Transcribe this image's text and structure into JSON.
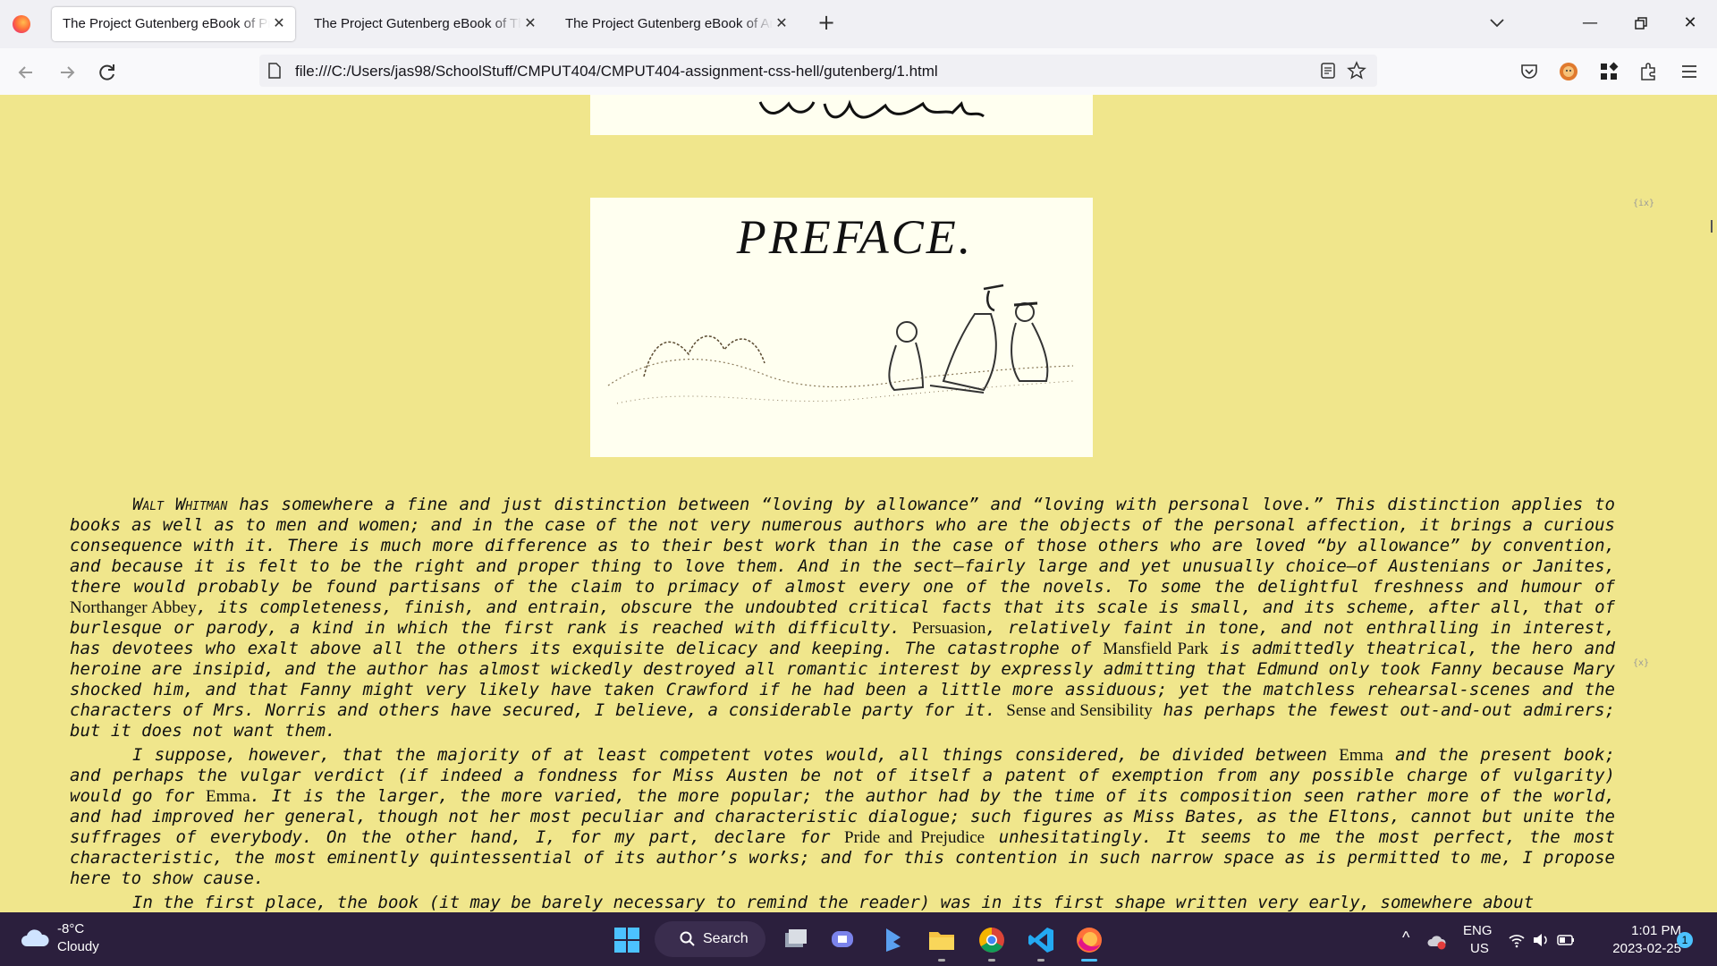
{
  "browser": {
    "tabs": [
      {
        "title": "The Project Gutenberg eBook of Pric",
        "active": true
      },
      {
        "title": "The Project Gutenberg eBook of The",
        "active": false
      },
      {
        "title": "The Project Gutenberg eBook of Ani",
        "active": false
      }
    ],
    "url": "file:///C:/Users/jas98/SchoolStuff/CMPUT404/CMPUT404-assignment-css-hell/gutenberg/1.html"
  },
  "page": {
    "preface_title": "PREFACE.",
    "page_marker_1": "{ix}",
    "page_marker_2": "{x}",
    "para1": {
      "lead": "Walt Whitman",
      "rest": " has somewhere a fine and just distinction between “loving by allowance” and “loving with personal love.” This distinction applies to books as well as to men and women; and in the case of the not very numerous authors who are the objects of the personal affection, it brings a curious consequence with it. There is much more difference as to their best work than in the case of those others who are loved “by allowance” by convention, and because it is felt to be the right and proper thing to love them. And in the sect—fairly large and yet unusually choice—of Austenians or Janites, there would probably be found partisans of the claim to primacy of almost every one of the novels. To some the delightful freshness and humour of ",
      "title1": "Northanger Abbey",
      "rest2": ", its completeness, finish, and entrain, obscure the undoubted critical facts that its scale is small, and its scheme, after all, that of burlesque or parody, a kind in which the first rank is reached with difficulty. ",
      "title2": "Persuasion",
      "rest3": ", relatively faint in tone, and not enthralling in interest, has devotees who exalt above all the others its exquisite delicacy and keeping. The catastrophe of ",
      "title3": "Mansfield Park",
      "rest4": " is admittedly theatrical, the hero and heroine are insipid, and the author has almost wickedly destroyed all romantic interest by expressly admitting that Edmund only took Fanny because Mary shocked him, and that Fanny might very likely have taken Crawford if he had been a little more assiduous; yet the matchless rehearsal-scenes and the characters of Mrs. Norris and others have secured, I believe, a considerable party for it. ",
      "title4": "Sense and Sensibility",
      "rest5": " has perhaps the fewest out-and-out admirers; but it does not want them."
    },
    "para2": {
      "a": "I suppose, however, that the majority of at least competent votes would, all things considered, be divided between ",
      "t1": "Emma",
      "b": " and the present book; and perhaps the vulgar verdict (if indeed a fondness for Miss Austen be not of itself a patent of exemption from any possible charge of vulgarity) would go for ",
      "t2": "Emma",
      "c": ". It is the larger, the more varied, the more popular; the author had by the time of its composition seen rather more of the world, and had improved her general, though not her most peculiar and characteristic dialogue; such figures as Miss Bates, as the Eltons, cannot but unite the suffrages of everybody. On the other hand, I, for my part, declare for ",
      "t3": "Pride and Prejudice",
      "d": " unhesitatingly. It seems to me the most perfect, the most characteristic, the most eminently quintessential of its author’s works; and for this contention in such narrow space as is permitted to me, I propose here to show cause."
    },
    "para3": "In the first place, the book (it may be barely necessary to remind the reader) was in its first shape written very early, somewhere about"
  },
  "taskbar": {
    "temp": "-8°C",
    "condition": "Cloudy",
    "search_label": "Search",
    "lang": "ENG",
    "region": "US",
    "time": "1:01 PM",
    "date": "2023-02-25",
    "notif_count": "1"
  },
  "colors": {
    "page_bg": "#f0e68c",
    "image_bg": "#fffff0",
    "taskbar_bg": "#2b1f3d",
    "accent": "#4cc2ff"
  }
}
